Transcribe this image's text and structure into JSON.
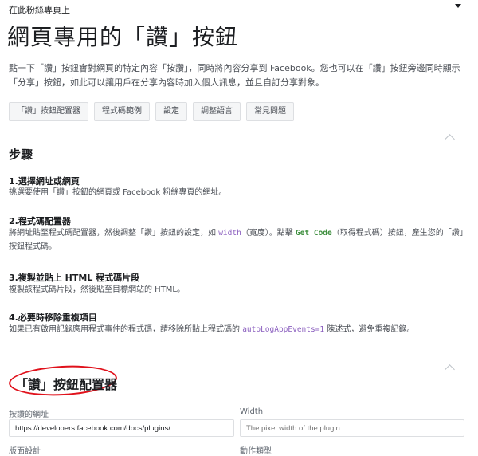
{
  "topbar": {
    "label": "在此粉絲專頁上",
    "menu_icon": "caret-down-icon"
  },
  "title": "網頁專用的「讚」按鈕",
  "intro": "點一下「讚」按鈕會對網頁的特定內容「按讚」，同時將內容分享到 Facebook。您也可以在「讚」按鈕旁邊同時顯示「分享」按鈕，如此可以讓用戶在分享內容時加入個人訊息，並且自訂分享對象。",
  "tabs": [
    "「讚」按鈕配置器",
    "程式碼範例",
    "設定",
    "調整語言",
    "常見問題"
  ],
  "steps_section": {
    "heading": "步驟",
    "steps": [
      {
        "title": "1.選擇網址或網頁",
        "desc": "挑選要使用「讚」按鈕的網頁或 Facebook 粉絲專頁的網址。"
      },
      {
        "title": "2.程式碼配置器",
        "desc_a": "將網址貼至程式碼配置器，然後調整「讚」按鈕的設定，如 ",
        "code_1": "width",
        "desc_b": "（寬度）。點擊 ",
        "code_2": "Get Code",
        "desc_c": "（取得程式碼）按鈕，產生您的「讚」按鈕程式碼。"
      },
      {
        "title": "3.複製並貼上 HTML 程式碼片段",
        "desc": "複製該程式碼片段，然後貼至目標網站的 HTML。"
      },
      {
        "title": "4.必要時移除重複項目",
        "desc_a": "如果已有啟用記錄應用程式事件的程式碼，請移除所貼上程式碼的 ",
        "code": "autoLogAppEvents=1",
        "desc_b": " 陳述式，避免重複記錄。"
      }
    ]
  },
  "configurator": {
    "heading": "「讚」按鈕配置器",
    "url_label": "按讚的網址",
    "url_value": "https://developers.facebook.com/docs/plugins/",
    "width_label": "Width",
    "width_placeholder": "The pixel width of the plugin",
    "layout_label": "版面設計",
    "action_label": "動作類型"
  },
  "colors": {
    "annotation": "#e0111b"
  }
}
